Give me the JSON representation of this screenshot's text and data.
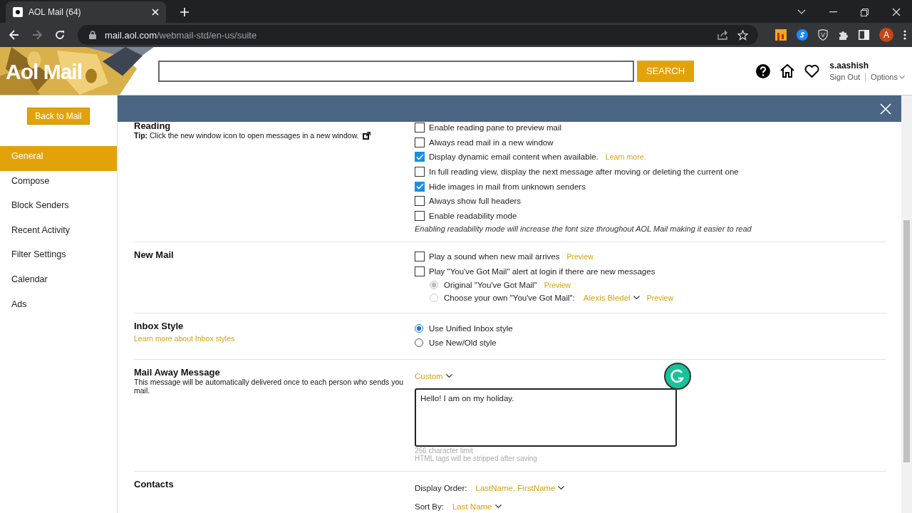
{
  "browser": {
    "tab_title": "AOL Mail (64)",
    "url_host": "mail.aol.com",
    "url_path": "/webmail-std/en-us/suite",
    "profile_initial": "A"
  },
  "header": {
    "logo": "Aol Mail",
    "search_button": "SEARCH",
    "user": "s.aashish",
    "sign_out": "Sign Out",
    "options": "Options"
  },
  "sidebar": {
    "back_button": "Back to Mail",
    "items": [
      {
        "label": "General",
        "selected": true
      },
      {
        "label": "Compose",
        "selected": false
      },
      {
        "label": "Block Senders",
        "selected": false
      },
      {
        "label": "Recent Activity",
        "selected": false
      },
      {
        "label": "Filter Settings",
        "selected": false
      },
      {
        "label": "Calendar",
        "selected": false
      },
      {
        "label": "Ads",
        "selected": false
      }
    ]
  },
  "sections": [
    {
      "title": "Reading",
      "description": "**Tip:** Click the new window icon to open messages in a new window.",
      "options": [
        {
          "kind": "checkbox",
          "label": "Enable reading pane to preview mail",
          "checked": false
        },
        {
          "kind": "checkbox",
          "label": "Always read mail in a new window",
          "checked": false
        },
        {
          "kind": "checkbox",
          "label": "Display dynamic email content when available.",
          "checked": true,
          "link": "Learn more."
        },
        {
          "kind": "checkbox",
          "label": "In full reading view, display the next message after moving or deleting the current one",
          "checked": false
        },
        {
          "kind": "checkbox",
          "label": "Hide images in mail from unknown senders",
          "checked": true
        },
        {
          "kind": "checkbox",
          "label": "Always show full headers",
          "checked": false
        },
        {
          "kind": "checkbox",
          "label": "Enable readability mode",
          "checked": false
        },
        {
          "kind": "note",
          "text": "Enabling readability mode will increase the font size throughout AOL Mail making it easier to read"
        }
      ]
    },
    {
      "title": "New Mail",
      "options": [
        {
          "kind": "checkbox",
          "label": "Play a sound when new mail arrives",
          "checked": false,
          "link": "Preview"
        },
        {
          "kind": "checkbox",
          "label": "Play \"You've Got Mail\" alert at login if there are new messages",
          "checked": false,
          "children": [
            {
              "kind": "radio",
              "label": "Original \"You've Got Mail\"",
              "selected": true,
              "disabled": true,
              "link": "Preview"
            },
            {
              "kind": "radio",
              "label": "Choose your own \"You've Got Mail\":",
              "selected": false,
              "disabled": true,
              "value": "Alexis Bledel",
              "link": "Preview"
            }
          ]
        }
      ]
    },
    {
      "title": "Inbox Style",
      "link": "Learn more about Inbox styles",
      "options": [
        {
          "kind": "radio",
          "label": "Use Unified Inbox style",
          "selected": true,
          "disabled": false
        },
        {
          "kind": "radio",
          "label": "Use New/Old style",
          "selected": false,
          "disabled": false
        }
      ]
    },
    {
      "title": "Mail Away Message",
      "description": "This message will be automatically delivered once to each person who sends you mail.",
      "options": [
        {
          "kind": "dropdown",
          "value": "Custom"
        },
        {
          "kind": "textarea",
          "value": "Hello! I am on my holiday."
        },
        {
          "kind": "hint",
          "text": "256 character limit"
        },
        {
          "kind": "hint",
          "text": "HTML tags will be stripped after saving"
        }
      ]
    },
    {
      "title": "Contacts",
      "options": [
        {
          "kind": "dropdown",
          "label": "Display Order:",
          "value": "LastName, FirstName"
        },
        {
          "kind": "dropdown",
          "label": "Sort By:",
          "value": "Last Name"
        }
      ]
    }
  ]
}
